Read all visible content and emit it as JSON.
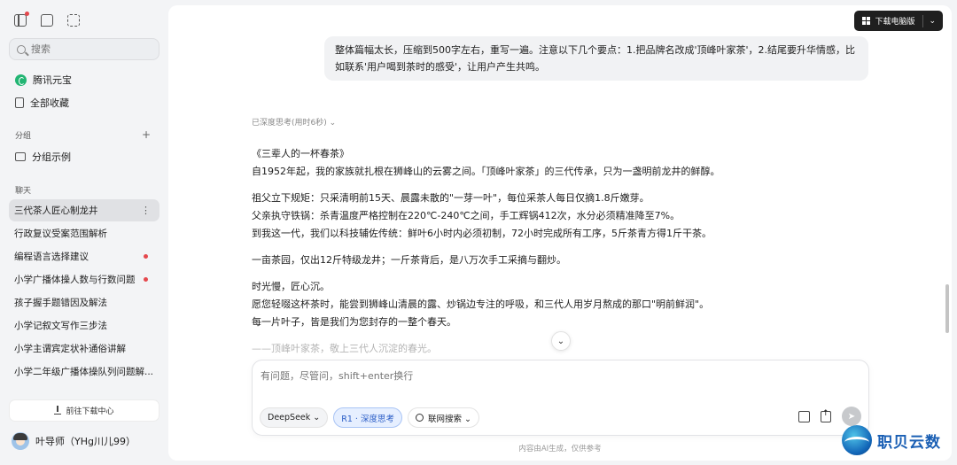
{
  "sidebar": {
    "search_placeholder": "搜索",
    "nav": [
      {
        "label": "腾讯元宝",
        "icon": "yuanbao-logo-icon"
      },
      {
        "label": "全部收藏",
        "icon": "bookmark-icon"
      }
    ],
    "group_section_label": "分组",
    "group_add": "+",
    "group_item": "分组示例",
    "chat_section_label": "聊天",
    "chats": [
      {
        "label": "三代茶人匠心制龙井",
        "active": true
      },
      {
        "label": "行政复议受案范围解析"
      },
      {
        "label": "编程语言选择建议",
        "unread": true
      },
      {
        "label": "小学广播体操人数与行数问题",
        "unread": true
      },
      {
        "label": "孩子握手题错因及解法"
      },
      {
        "label": "小学记叙文写作三步法"
      },
      {
        "label": "小学主谓宾定状补通俗讲解"
      },
      {
        "label": "小学二年级广播体操队列问题解..."
      }
    ],
    "more_icon": "⋮",
    "download_center": "前往下载中心",
    "user_name": "叶导师（YHg川儿99）"
  },
  "header": {
    "download_pc": "下载电脑版",
    "chevron": "⌄"
  },
  "conversation": {
    "user_message": "整体篇幅太长，压缩到500字左右，重写一遍。注意以下几个要点：1.把品牌名改成'顶峰叶家茶'，2.结尾要升华情感，比如联系'用户喝到茶时的感受'，让用户产生共鸣。",
    "thinking_label": "已深度思考(用时6秒) ⌄",
    "answer": {
      "p1_l1": "《三辈人的一杯春茶》",
      "p1_l2": "自1952年起，我的家族就扎根在狮峰山的云雾之间。「顶峰叶家茶」的三代传承，只为一盏明前龙井的鲜醇。",
      "p2_l1": "祖父立下规矩：只采清明前15天、晨露未散的\"一芽一叶\"，每位采茶人每日仅摘1.8斤嫩芽。",
      "p2_l2": "父亲执守铁锅：杀青温度严格控制在220℃-240℃之间，手工辉锅412次，水分必须精准降至7%。",
      "p2_l3": "到我这一代，我们以科技辅佐传统：鲜叶6小时内必须初制，72小时完成所有工序，5斤茶青方得1斤干茶。",
      "p3_l1": "一亩茶园，仅出12斤特级龙井；一斤茶背后，是八万次手工采摘与翻炒。",
      "p4_l1": "时光慢，匠心沉。",
      "p4_l2": "愿您轻啜这杯茶时，能尝到狮峰山清晨的露、炒锅边专注的呼吸，和三代人用岁月熬成的那口\"明前鲜润\"。",
      "p4_l3": "每一片叶子，皆是我们为您封存的一整个春天。",
      "p5_l1": "——顶峰叶家茶，敬上三代人沉淀的春光。"
    },
    "scroll_down": "⌄"
  },
  "composer": {
    "placeholder": "有问题，尽管问，shift+enter换行",
    "model_chip": "DeepSeek ⌄",
    "deep_think_chip": "R1 · 深度思考",
    "web_search_chip": "联网搜索 ⌄",
    "send_icon": "➤"
  },
  "disclaimer": "内容由AI生成，仅供参考",
  "watermark": "职贝云数"
}
